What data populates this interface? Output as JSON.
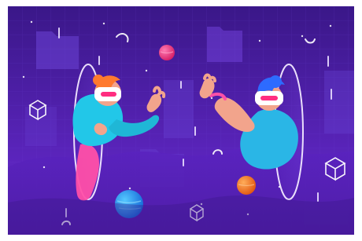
{
  "illustration": {
    "subject": "metaverse-vr-meeting",
    "palette": {
      "background_top": "#3a1788",
      "background_bottom": "#6b2bd6",
      "panel": "#5b2fc4",
      "portal_edge": "#f2e9ff",
      "woman_hair": "#ff7a2e",
      "woman_shirt": "#22c7e8",
      "woman_pants": "#ff4fa8",
      "man_hair": "#2d6bff",
      "man_shirt": "#2ab6e6",
      "skin": "#f2a48c",
      "headset": "#ffffff",
      "lens": "#ff2d80",
      "planet_pink": "#ff3f86",
      "planet_orange": "#ff7a1a",
      "planet_blue": "#1f8dff"
    },
    "icons": [
      "cube-icon",
      "folder-icon",
      "planet-icon",
      "star-icon",
      "swirl-icon"
    ]
  }
}
